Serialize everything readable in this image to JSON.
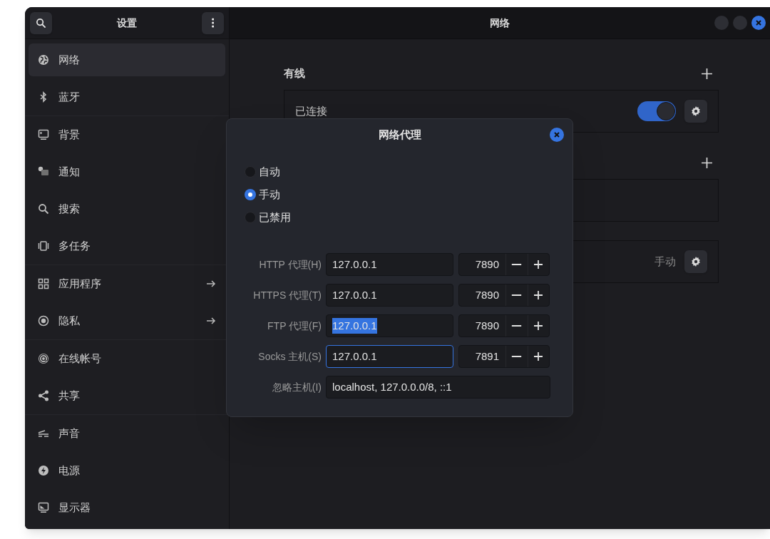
{
  "sidebar": {
    "title": "设置",
    "groups": [
      [
        {
          "label": "网络",
          "selected": true,
          "arrow": false
        },
        {
          "label": "蓝牙",
          "selected": false,
          "arrow": false
        }
      ],
      [
        {
          "label": "背景",
          "selected": false,
          "arrow": false
        },
        {
          "label": "通知",
          "selected": false,
          "arrow": false
        },
        {
          "label": "搜索",
          "selected": false,
          "arrow": false
        },
        {
          "label": "多任务",
          "selected": false,
          "arrow": false
        }
      ],
      [
        {
          "label": "应用程序",
          "selected": false,
          "arrow": true
        },
        {
          "label": "隐私",
          "selected": false,
          "arrow": true
        }
      ],
      [
        {
          "label": "在线帐号",
          "selected": false,
          "arrow": false
        },
        {
          "label": "共享",
          "selected": false,
          "arrow": false
        }
      ],
      [
        {
          "label": "声音",
          "selected": false,
          "arrow": false
        },
        {
          "label": "电源",
          "selected": false,
          "arrow": false
        },
        {
          "label": "显示器",
          "selected": false,
          "arrow": false
        }
      ]
    ]
  },
  "main": {
    "title": "网络",
    "sections": [
      {
        "heading": "有线",
        "add": true,
        "row": {
          "label": "已连接",
          "on": true
        }
      },
      {
        "add": true
      },
      {
        "add": false,
        "row": {
          "status": "手动"
        }
      }
    ]
  },
  "dialog": {
    "title": "网络代理",
    "modes": [
      {
        "label": "自动",
        "selected": false
      },
      {
        "label": "手动",
        "selected": true
      },
      {
        "label": "已禁用",
        "selected": false
      }
    ],
    "proxies": [
      {
        "label": "HTTP 代理(H)",
        "host": "127.0.0.1",
        "port": "7890",
        "focused": false,
        "text_selected": false
      },
      {
        "label": "HTTPS 代理(T)",
        "host": "127.0.0.1",
        "port": "7890",
        "focused": false,
        "text_selected": false
      },
      {
        "label": "FTP 代理(F)",
        "host": "127.0.0.1",
        "port": "7890",
        "focused": false,
        "text_selected": true
      },
      {
        "label": "Socks 主机(S)",
        "host": "127.0.0.1",
        "port": "7891",
        "focused": true,
        "text_selected": false
      }
    ],
    "ignore": {
      "label": "忽略主机(I)",
      "value": "localhost, 127.0.0.0/8, ::1"
    }
  }
}
